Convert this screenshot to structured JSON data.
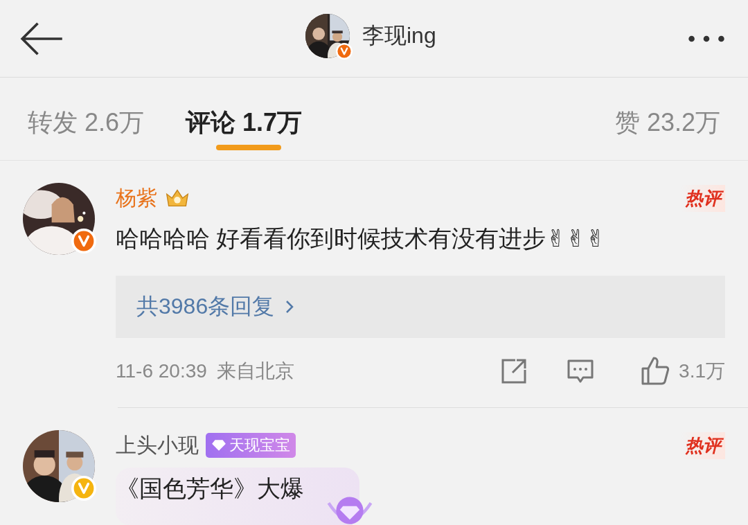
{
  "header": {
    "title": "李现ing",
    "verified": {
      "color": "#f06a0f"
    }
  },
  "tabs": [
    {
      "label": "转发",
      "count": "2.6万",
      "selected": false
    },
    {
      "label": "评论",
      "count": "1.7万",
      "selected": true
    },
    {
      "label": "赞",
      "count": "23.2万",
      "selected": false
    }
  ],
  "comments": [
    {
      "name": "杨紫",
      "vip": true,
      "verified": {
        "color": "#f06a0f"
      },
      "badge": "热评",
      "text": "哈哈哈哈 好看看你到时候技术有没有进步✌✌✌",
      "bubble": false,
      "replies": "共3986条回复",
      "time": "11-6 20:39",
      "location": "来自北京",
      "likes": "3.1万"
    },
    {
      "name": "上头小现",
      "vip": false,
      "verified": {
        "color": "#f5b40f"
      },
      "badge": "热评",
      "fan_badge": "天现宝宝",
      "text": "《国色芳华》大爆",
      "bubble": true
    }
  ]
}
